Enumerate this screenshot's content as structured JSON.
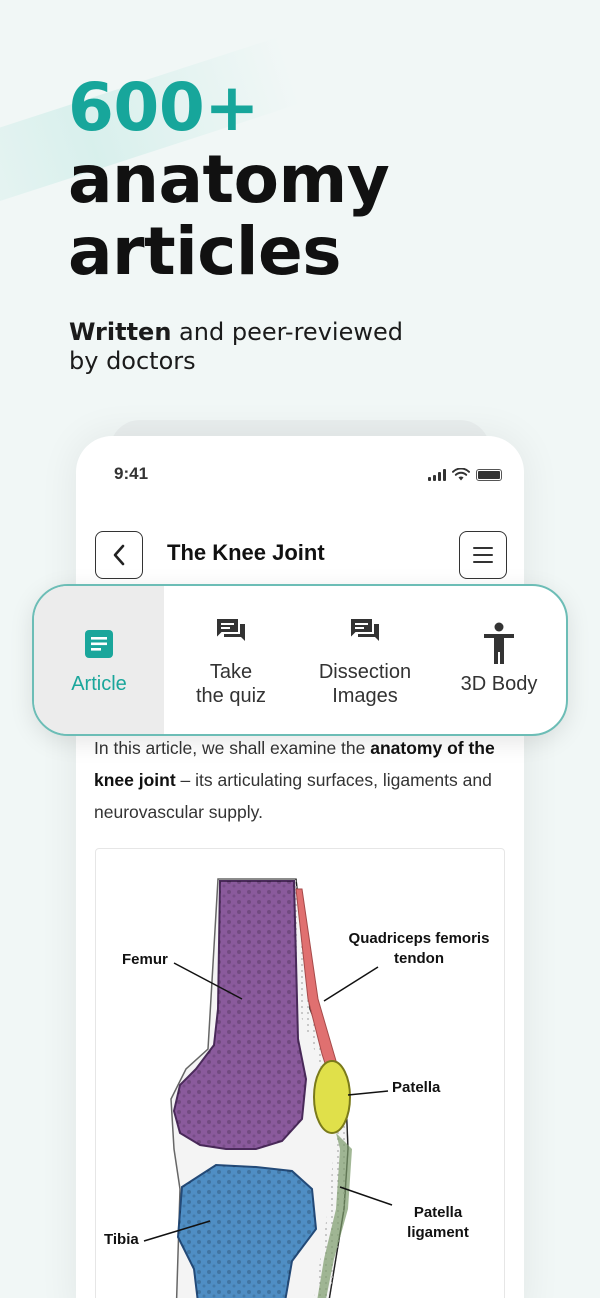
{
  "headline": {
    "accent": "600+",
    "line2": "anatomy",
    "line3": "articles"
  },
  "subline": {
    "bold": "Written",
    "rest": " and peer-reviewed by doctors"
  },
  "status_bar": {
    "time": "9:41"
  },
  "header": {
    "title": "The Knee Joint"
  },
  "tabs": [
    {
      "label": "Article",
      "icon": "article-icon",
      "active": true
    },
    {
      "label": "Take\nthe quiz",
      "icon": "chat-icon",
      "active": false
    },
    {
      "label": "Dissection\nImages",
      "icon": "chat-icon",
      "active": false
    },
    {
      "label": "3D Body",
      "icon": "person-icon",
      "active": false
    }
  ],
  "article": {
    "intro_1": "In this article, we shall examine the ",
    "intro_bold": "anatomy of the knee joint",
    "intro_2": " – its articulating surfaces, ligaments and neurovascular supply."
  },
  "figure": {
    "labels": {
      "femur": "Femur",
      "quadriceps": "Quadriceps femoris tendon",
      "patella": "Patella",
      "patella_ligament": "Patella ligament",
      "tibia": "Tibia"
    }
  },
  "colors": {
    "accent": "#17a69b",
    "tab_border": "#6cbdb6",
    "femur": "#8a5a9c",
    "tibia": "#4f8ec4",
    "patella": "#e0e04a",
    "tendon": "#e07070"
  }
}
